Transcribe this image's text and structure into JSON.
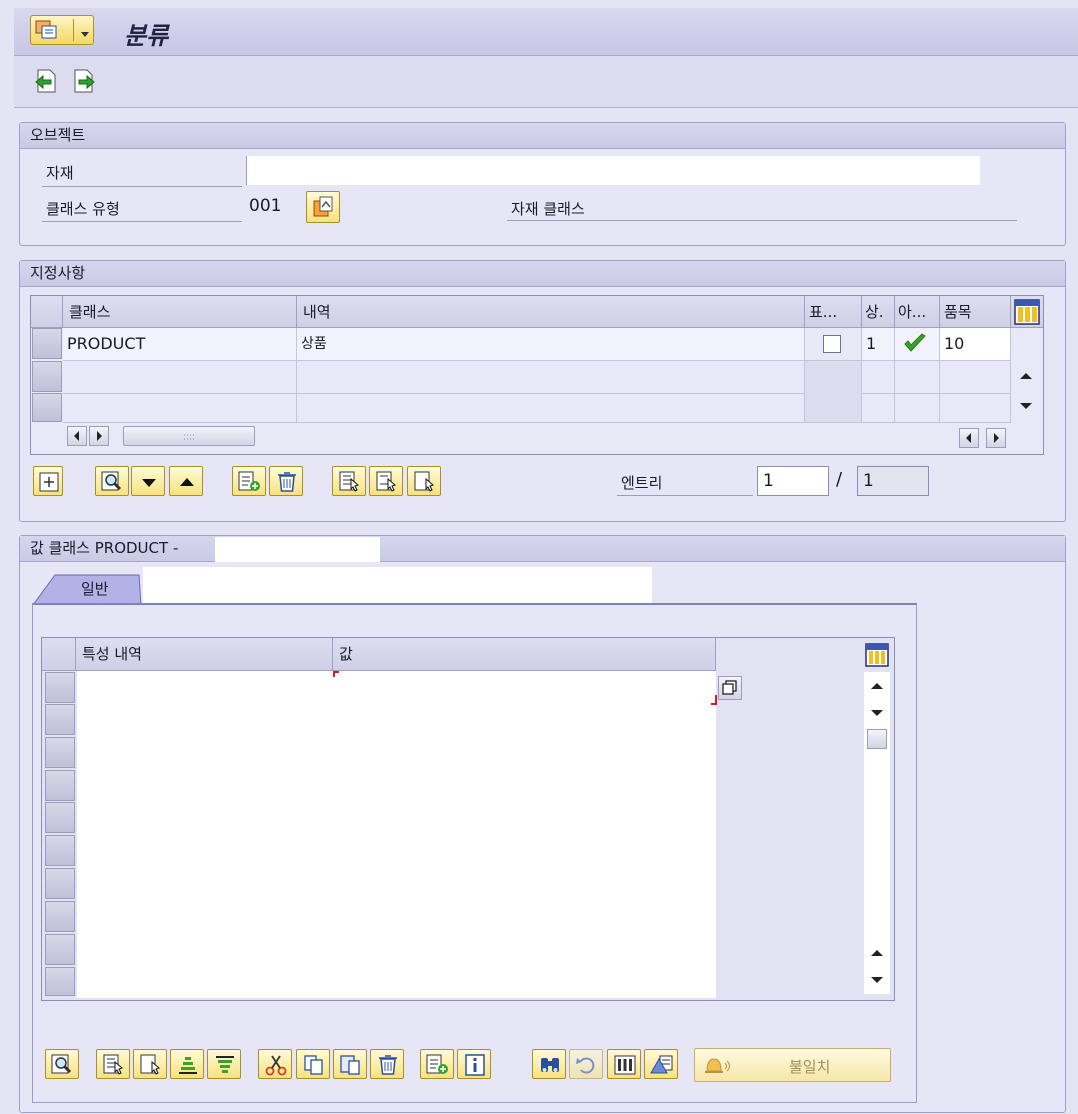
{
  "window": {
    "title": "분류"
  },
  "object_group": {
    "header": "오브젝트",
    "material_label": "자재",
    "class_type_label": "클래스 유형",
    "class_type_value": "001",
    "class_type_desc": "자재 클래스"
  },
  "assignment_group": {
    "header": "지정사항",
    "columns": [
      "클래스",
      "내역",
      "표...",
      "상.",
      "아...",
      "품목"
    ],
    "rows": [
      {
        "class": "PRODUCT",
        "desc": "상품",
        "std_checked": false,
        "status": "1",
        "ok": true,
        "item": "10"
      },
      {
        "class": "",
        "desc": "",
        "std_checked": null,
        "status": "",
        "ok": null,
        "item": ""
      },
      {
        "class": "",
        "desc": "",
        "std_checked": null,
        "status": "",
        "ok": null,
        "item": ""
      }
    ],
    "entry_label": "엔트리",
    "entry_current": "1",
    "entry_sep": "/",
    "entry_total": "1"
  },
  "value_group": {
    "header": "값 클래스 PRODUCT -",
    "tab_general": "일반",
    "columns": [
      "특성 내역",
      "값"
    ],
    "mismatch_button": "불일치"
  },
  "colors": {
    "background": "#e4e4f4",
    "button_yellow": "#f7e27c",
    "check_green": "#3aa22a"
  }
}
